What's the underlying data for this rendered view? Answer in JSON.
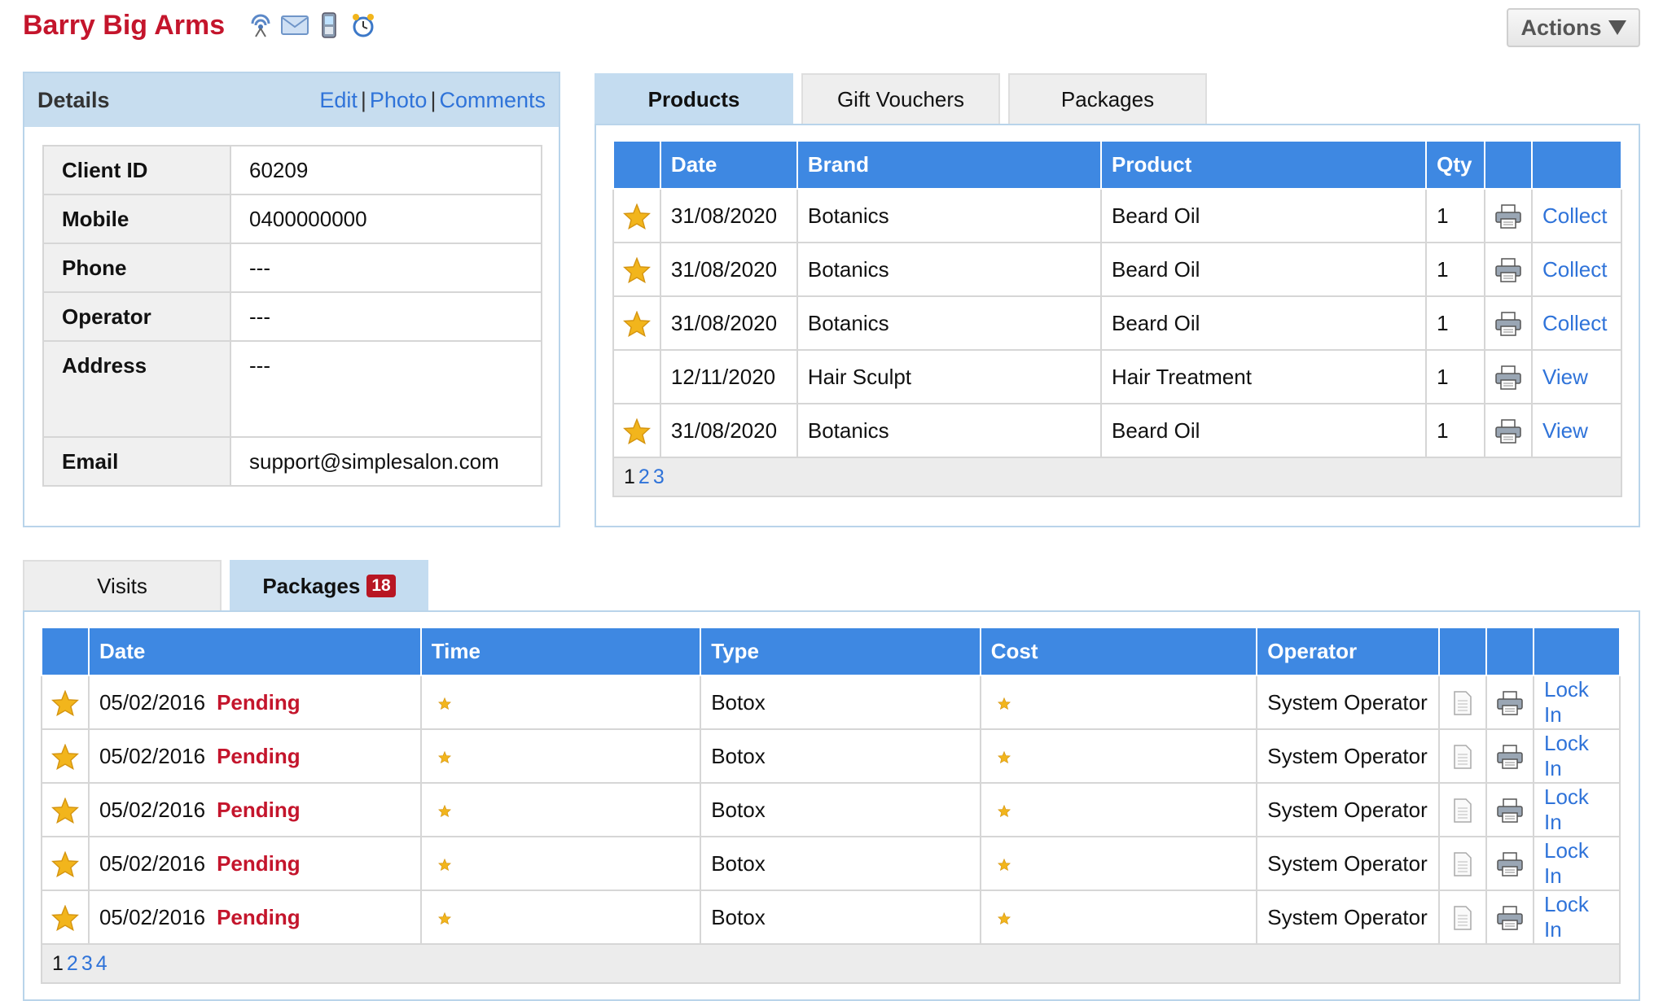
{
  "client": {
    "name": "Barry Big Arms"
  },
  "header_icons": [
    "wireless-icon",
    "envelope-icon",
    "mobile-phone-icon",
    "alarm-clock-icon"
  ],
  "actions": {
    "label": "Actions"
  },
  "details": {
    "title": "Details",
    "links": {
      "edit": "Edit",
      "photo": "Photo",
      "comments": "Comments",
      "separator": "|"
    },
    "rows": [
      {
        "label": "Client ID",
        "value": "60209"
      },
      {
        "label": "Mobile",
        "value": "0400000000"
      },
      {
        "label": "Phone",
        "value": "---"
      },
      {
        "label": "Operator",
        "value": "---"
      },
      {
        "label": "Address",
        "value": "---"
      },
      {
        "label": "Email",
        "value": "support@simplesalon.com"
      }
    ]
  },
  "product_tabs": [
    {
      "label": "Products",
      "active": true
    },
    {
      "label": "Gift Vouchers",
      "active": false
    },
    {
      "label": "Packages",
      "active": false
    }
  ],
  "products": {
    "columns": [
      "",
      "Date",
      "Brand",
      "Product",
      "Qty",
      "",
      ""
    ],
    "rows": [
      {
        "star": true,
        "date": "31/08/2020",
        "brand": "Botanics",
        "product": "Beard Oil",
        "qty": "1",
        "action": "Collect"
      },
      {
        "star": true,
        "date": "31/08/2020",
        "brand": "Botanics",
        "product": "Beard Oil",
        "qty": "1",
        "action": "Collect"
      },
      {
        "star": true,
        "date": "31/08/2020",
        "brand": "Botanics",
        "product": "Beard Oil",
        "qty": "1",
        "action": "Collect"
      },
      {
        "star": false,
        "date": "12/11/2020",
        "brand": "Hair Sculpt",
        "product": "Hair Treatment",
        "qty": "1",
        "action": "View"
      },
      {
        "star": true,
        "date": "31/08/2020",
        "brand": "Botanics",
        "product": "Beard Oil",
        "qty": "1",
        "action": "View"
      }
    ],
    "pagination": {
      "current": "1",
      "pages": [
        "2",
        "3"
      ]
    }
  },
  "bottom_tabs": [
    {
      "label": "Visits",
      "active": false
    },
    {
      "label": "Packages",
      "active": true,
      "badge": "18"
    }
  ],
  "packages": {
    "columns": [
      "",
      "Date",
      "Time",
      "Type",
      "Cost",
      "Operator",
      "",
      "",
      ""
    ],
    "rows": [
      {
        "date": "05/02/2016",
        "status": "Pending",
        "type": "Botox",
        "operator": "System Operator",
        "action": "Lock In"
      },
      {
        "date": "05/02/2016",
        "status": "Pending",
        "type": "Botox",
        "operator": "System Operator",
        "action": "Lock In"
      },
      {
        "date": "05/02/2016",
        "status": "Pending",
        "type": "Botox",
        "operator": "System Operator",
        "action": "Lock In"
      },
      {
        "date": "05/02/2016",
        "status": "Pending",
        "type": "Botox",
        "operator": "System Operator",
        "action": "Lock In"
      },
      {
        "date": "05/02/2016",
        "status": "Pending",
        "type": "Botox",
        "operator": "System Operator",
        "action": "Lock In"
      }
    ],
    "pagination": {
      "current": "1",
      "pages": [
        "2",
        "3",
        "4"
      ]
    }
  },
  "colors": {
    "accent": "#3e88e2",
    "tab_active": "#c4dcf0",
    "client_name": "#c4152c",
    "link": "#2f73d9",
    "pending": "#c4152c",
    "badge": "#b81623",
    "star": "#f2b51c"
  },
  "icons": {
    "row_star": "star-icon",
    "small_star": "small-star-icon",
    "print": "printer-icon",
    "document": "document-icon"
  }
}
